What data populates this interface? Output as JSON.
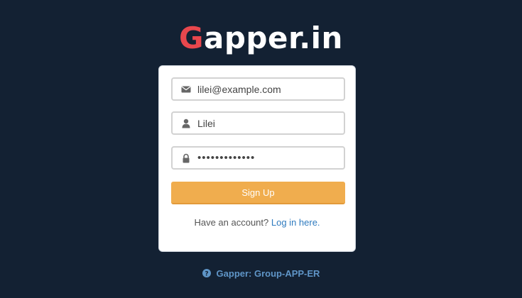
{
  "logo": {
    "first_letter": "G",
    "rest": "apper.in",
    "accent_color": "#e8474d"
  },
  "form": {
    "email": {
      "value": "lilei@example.com",
      "icon": "envelope-icon"
    },
    "name": {
      "value": "Lilei",
      "icon": "user-icon"
    },
    "password": {
      "value": "•••••••••••••",
      "icon": "lock-icon"
    },
    "signup_label": "Sign Up",
    "signup_color": "#f0ad4e",
    "account_prompt": "Have an account?",
    "login_link": "Log in here."
  },
  "footer": {
    "icon": "question-circle-icon",
    "text": "Gapper: Group-APP-ER"
  },
  "colors": {
    "background": "#132133",
    "link": "#2f7bbf",
    "footer_link": "#5f95c7"
  }
}
